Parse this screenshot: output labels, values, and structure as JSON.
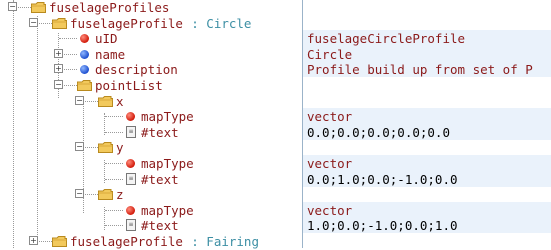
{
  "tree": {
    "rows": [
      {
        "key": "fuselageProfiles",
        "type": ""
      },
      {
        "key": "fuselageProfile",
        "type": ": Circle"
      },
      {
        "key": "uID",
        "type": ""
      },
      {
        "key": "name",
        "type": ""
      },
      {
        "key": "description",
        "type": ""
      },
      {
        "key": "pointList",
        "type": ""
      },
      {
        "key": "x",
        "type": ""
      },
      {
        "key": "mapType",
        "type": ""
      },
      {
        "key": "#text",
        "type": ""
      },
      {
        "key": "y",
        "type": ""
      },
      {
        "key": "mapType",
        "type": ""
      },
      {
        "key": "#text",
        "type": ""
      },
      {
        "key": "z",
        "type": ""
      },
      {
        "key": "mapType",
        "type": ""
      },
      {
        "key": "#text",
        "type": ""
      },
      {
        "key": "fuselageProfile",
        "type": ": Fairing"
      }
    ]
  },
  "values": [
    "",
    "",
    "fuselageCircleProfile",
    "Circle",
    "Profile build up from set of P",
    "",
    "",
    "vector",
    "0.0;0.0;0.0;0.0;0.0",
    "",
    "vector",
    "0.0;1.0;0.0;-1.0;0.0",
    "",
    "vector",
    "1.0;0.0;-1.0;0.0;1.0",
    ""
  ],
  "icons": {
    "folder": "folder-icon",
    "attribute": "attribute-dot-icon",
    "element": "element-dot-icon",
    "text": "text-node-icon",
    "expanded": "collapse-minus-icon",
    "collapsed": "expand-plus-icon"
  },
  "colors": {
    "key": "#8b1a1a",
    "type_annotation": "#3d8fa4",
    "value": "#8b1a1a",
    "attribute_dot": "#d11a0a",
    "element_dot": "#1d4fcf",
    "folder": "#e8b84a",
    "value_row_shade": "#eaf2fb"
  }
}
